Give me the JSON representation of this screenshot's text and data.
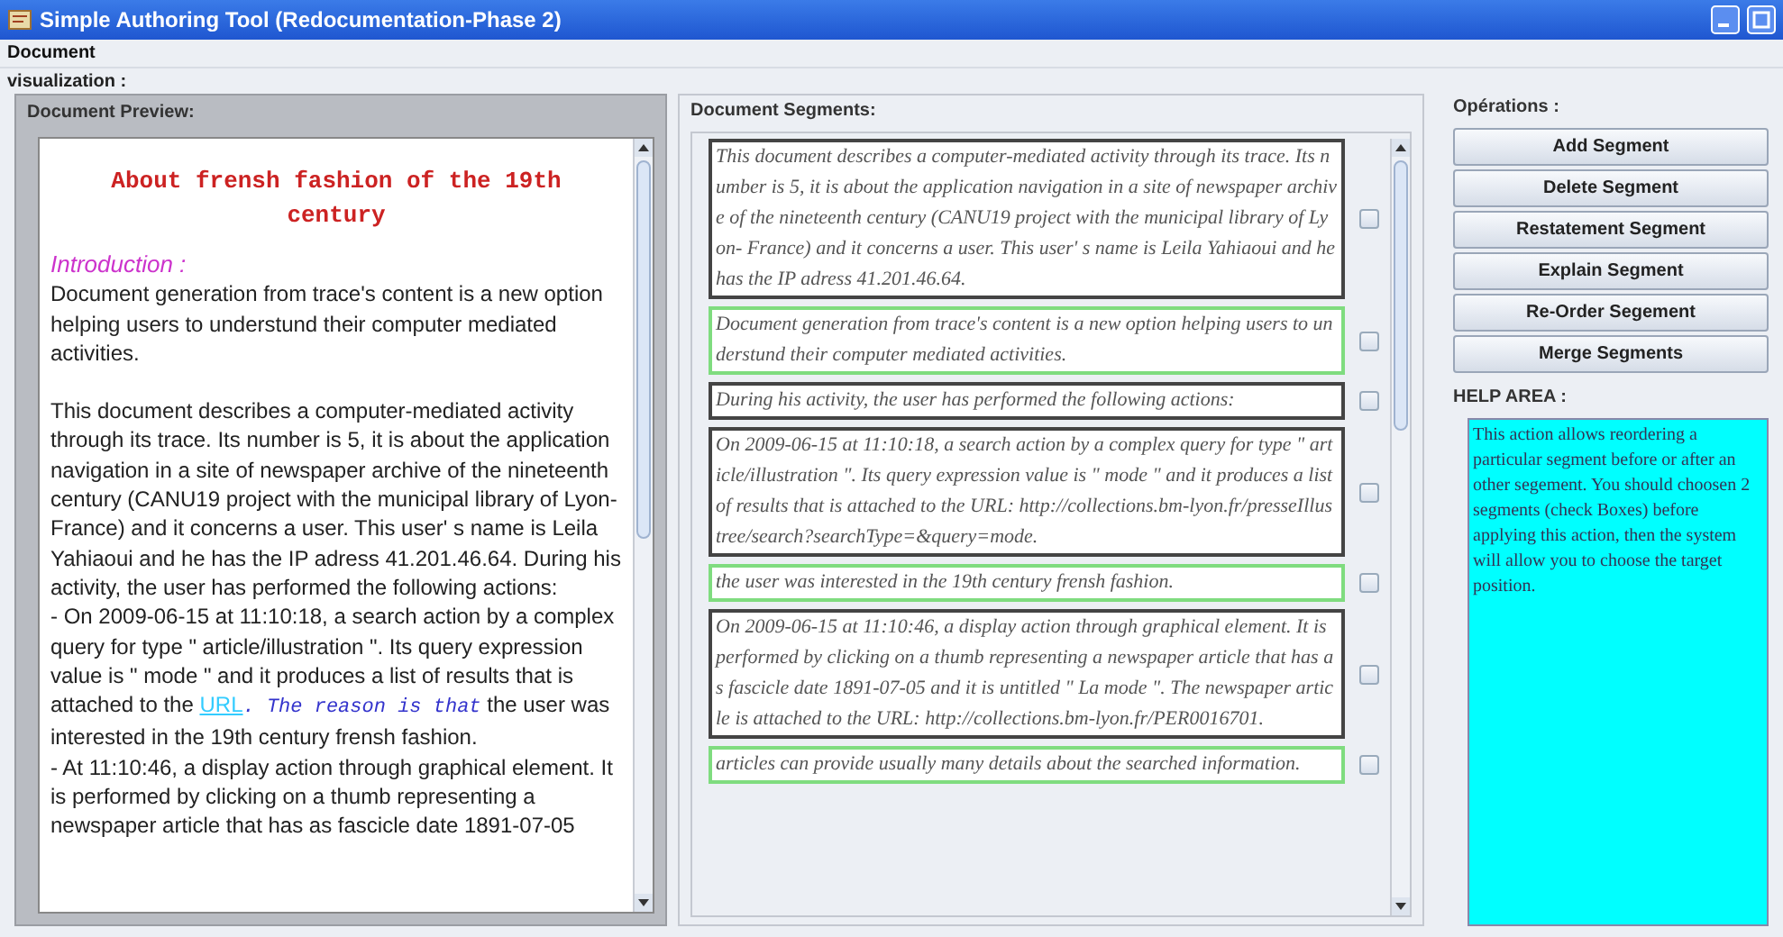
{
  "window": {
    "title": "Simple Authoring Tool (Redocumentation-Phase 2)"
  },
  "menu": [
    "Document"
  ],
  "section_label": "visualization :",
  "preview": {
    "label": "Document Preview:",
    "title": "About frensh fashion of the 19th century",
    "heading": "Introduction :",
    "paragraphs": [
      [
        {
          "kind": "text",
          "text": "Document generation from trace's content is a new option helping users to understund their computer mediated activities."
        }
      ],
      [
        {
          "kind": "text",
          "text": "This document describes a computer-mediated activity through its trace. Its number is 5, it is about the application navigation in a site of newspaper archive of the nineteenth century (CANU19 project with the municipal library of Lyon- France) and it concerns a user. This user' s name is Leila Yahiaoui and he has the IP adress 41.201.46.64. During his activity, the user has performed the following actions:"
        }
      ],
      [
        {
          "kind": "text",
          "text": "- On 2009-06-15 at 11:10:18, a search action by a complex query for type \" article/illustration \". Its query expression value is \" mode \" and it produces a list of results that is attached to the "
        },
        {
          "kind": "link",
          "text": "URL"
        },
        {
          "kind": "reason",
          "text": ". The reason is that"
        },
        {
          "kind": "text",
          "text": " the user was interested in the 19th century frensh fashion."
        }
      ],
      [
        {
          "kind": "text",
          "text": "- At 11:10:46, a display action through graphical element. It is performed by clicking on a thumb representing a newspaper article that has as fascicle date 1891-07-05"
        }
      ]
    ]
  },
  "segments_label": "Document Segments:",
  "segments": [
    {
      "kind": "trace",
      "checked": false,
      "text": "This document describes a computer-mediated activity through its trace. Its number is 5, it is about the application navigation in a site of newspaper archive of the nineteenth century (CANU19 project with the municipal library of Lyon- France) and it concerns a user. This user' s name is Leila Yahiaoui and he has the IP adress 41.201.46.64."
    },
    {
      "kind": "explanation",
      "checked": false,
      "text": "Document generation from trace's content is a new option helping users to understund their computer mediated activities."
    },
    {
      "kind": "trace",
      "checked": false,
      "text": "During his activity, the user has performed the following actions:"
    },
    {
      "kind": "trace",
      "checked": false,
      "text": "On 2009-06-15 at 11:10:18, a search action by a complex query for type \" article/illustration \". Its query expression value is \" mode \" and it produces a list of results that is attached to the URL: http://collections.bm-lyon.fr/presseIllustree/search?searchType=&query=mode."
    },
    {
      "kind": "explanation",
      "checked": false,
      "text": "the user was interested in the 19th century  frensh fashion."
    },
    {
      "kind": "trace",
      "checked": false,
      "text": "On 2009-06-15 at 11:10:46, a display action through graphical element. It is performed by clicking on a thumb representing a newspaper article that has as fascicle date 1891-07-05 and it is untitled \" La mode \". The newspaper article is attached to the URL: http://collections.bm-lyon.fr/PER0016701."
    },
    {
      "kind": "explanation",
      "checked": false,
      "text": "articles can provide usually many details about the searched information."
    }
  ],
  "operations": {
    "label": "Opérations :",
    "buttons": [
      "Add Segment",
      "Delete Segment",
      "Restatement Segment",
      "Explain Segment",
      "Re-Order Segement",
      "Merge Segments"
    ]
  },
  "help": {
    "label": "HELP AREA :",
    "text": "This action allows reordering a particular segment before or after an other segement. You should choosen 2 segments (check Boxes) before applying this action, then the system will allow you to choose the target position."
  }
}
